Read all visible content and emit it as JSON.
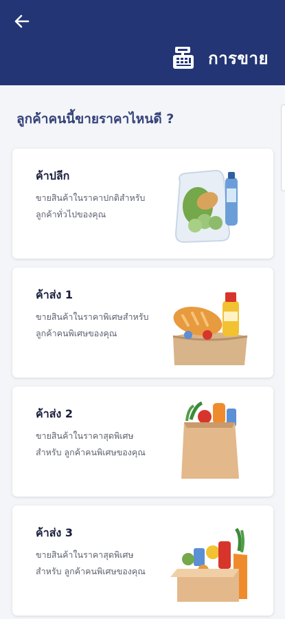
{
  "header": {
    "title": "การขาย",
    "back_icon": "arrow-left-icon",
    "title_icon": "cash-register-icon",
    "bg_color": "#233574"
  },
  "main": {
    "question": "ลูกค้าคนนี้ขายราคาไหนดี ?",
    "cards": [
      {
        "title": "ค้าปลีก",
        "desc_line1": "ขายสินค้าในราคาปกติสำหรับ",
        "desc_line2": "ลูกค้าทั่วไปของคุณ",
        "image": "grocery-plastic-bag-illustration"
      },
      {
        "title": "ค้าส่ง 1",
        "desc_line1": "ขายสินค้าในราคาพิเศษสำหรับ",
        "desc_line2": "ลูกค้าคนพิเศษของคุณ",
        "image": "bread-bag-illustration"
      },
      {
        "title": "ค้าส่ง 2",
        "desc_line1": "ขายสินค้าในราคาสุดพิเศษ",
        "desc_line2": "สำหรับ ลูกค้าคนพิเศษของคุณ",
        "image": "paper-grocery-bag-illustration"
      },
      {
        "title": "ค้าส่ง 3",
        "desc_line1": "ขายสินค้าในราคาสุดพิเศษ",
        "desc_line2": "สำหรับ ลูกค้าคนพิเศษของคุณ",
        "image": "grocery-box-illustration"
      }
    ]
  }
}
